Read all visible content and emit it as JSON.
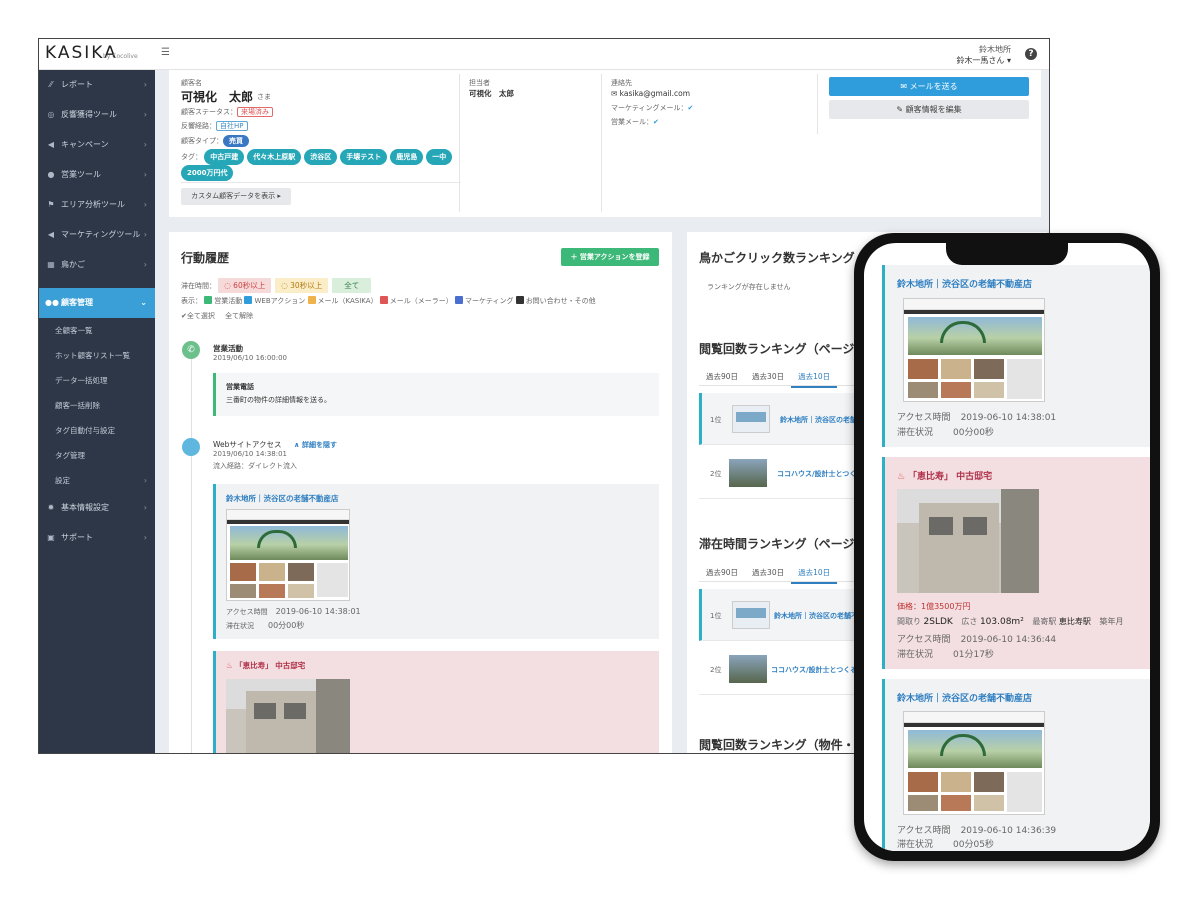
{
  "header": {
    "logo": "KASIKA",
    "logo_sub": "by Cocolive",
    "menu_icon": "☰",
    "company": "鈴木地所",
    "user": "鈴木一馬さん ▾"
  },
  "sidebar": {
    "items": [
      {
        "label": "レポート",
        "icon": "chart-icon"
      },
      {
        "label": "反響獲得ツール",
        "icon": "target-icon"
      },
      {
        "label": "キャンペーン",
        "icon": "megaphone-icon"
      },
      {
        "label": "営業ツール",
        "icon": "user-plus-icon"
      },
      {
        "label": "エリア分析ツール",
        "icon": "flag-icon"
      },
      {
        "label": "マーケティングツール",
        "icon": "bullhorn-icon"
      },
      {
        "label": "鳥かご",
        "icon": "grid-icon"
      },
      {
        "label": "顧客管理",
        "icon": "users-icon"
      }
    ],
    "sub_items": [
      "全顧客一覧",
      "ホット顧客リスト一覧",
      "データ一括処理",
      "顧客一括削除",
      "タグ自動付与設定",
      "タグ管理",
      "設定"
    ],
    "bottom_items": [
      {
        "label": "基本情報設定",
        "icon": "gear-icon"
      },
      {
        "label": "サポート",
        "icon": "id-card-icon"
      }
    ]
  },
  "profile": {
    "name_label": "顧客名",
    "name": "可視化　太郎",
    "honorific": "さま",
    "status_label": "顧客ステータス：",
    "status": "来場済み",
    "route_label": "反響経路：",
    "route": "自社HP",
    "type_label": "顧客タイプ：",
    "type": "売買",
    "tag_label": "タグ：",
    "tags": [
      "中古戸建",
      "代々木上原駅",
      "渋谷区",
      "手壊テスト",
      "鹿児島",
      "一中",
      "2000万円代"
    ],
    "custom_button": "カスタム顧客データを表示 ▸",
    "rep_label": "担当者",
    "rep": "可視化　太郎",
    "contact_label": "連絡先",
    "email": "kasika@gmail.com",
    "marketing_mail": "マーケティングメール：",
    "sales_mail": "営業メール：",
    "send_mail_button": "✉ メールを送る",
    "edit_button": "✎ 顧客情報を編集"
  },
  "activity": {
    "title": "行動履歴",
    "register_button": "＋ 営業アクションを登録",
    "stay_label": "滞在時間：",
    "stay_chips": [
      "60秒以上",
      "30秒以上",
      "全て"
    ],
    "display_label": "表示：",
    "filters": [
      {
        "label": "営業活動",
        "color": "#3cb878"
      },
      {
        "label": "WEBアクション",
        "color": "#2f9ddb"
      },
      {
        "label": "メール（KASIKA）",
        "color": "#f0b24a"
      },
      {
        "label": "メール（メーラー）",
        "color": "#e05555"
      },
      {
        "label": "マーケティング",
        "color": "#4a6fd0"
      },
      {
        "label": "お問い合わせ・その他",
        "color": "#333333"
      }
    ],
    "select_all": "✔全て選択",
    "deselect_all": "全て解除",
    "event1": {
      "title": "営業活動",
      "date": "2019/06/10 16:00:00",
      "note_title": "営業電話",
      "note_body": "三番町の物件の詳細情報を送る。"
    },
    "event2": {
      "title": "Webサイトアクセス",
      "toggle": "∧ 詳細を隠す",
      "date": "2019/06/10 14:38:01",
      "source": "流入経路：ダイレクト流入",
      "page_title": "鈴木地所｜渋谷区の老舗不動産店",
      "access_label": "アクセス時間",
      "access_time": "2019-06-10 14:38:01",
      "stay_label": "滞在状況",
      "stay_value": "00分00秒",
      "property_title": "「恵比寿」 中古邸宅"
    }
  },
  "ranking": {
    "birdcage_title": "鳥かごクリック数ランキング",
    "empty": "ランキングが存在しません",
    "views_title": "閲覧回数ランキング（ページ別）",
    "stay_title": "滞在時間ランキング（ページ別）",
    "property_title": "閲覧回数ランキング（物件・",
    "tabs": [
      "過去90日",
      "過去30日",
      "過去10日"
    ],
    "rows": [
      {
        "rank": "1位",
        "label": "鈴木地所｜渋谷区の老舗不動産店"
      },
      {
        "rank": "2位",
        "label": "ココハウス/設計士とつくる"
      }
    ]
  },
  "phone": {
    "cards": [
      {
        "title": "鈴木地所｜渋谷区の老舗不動産店",
        "access_label": "アクセス時間",
        "access_time": "2019-06-10 14:38:01",
        "stay_label": "滞在状況",
        "stay_value": "00分00秒"
      },
      {
        "title": "「恵比寿」 中古邸宅",
        "price": "価格：1億3500万円",
        "layout_label": "間取り",
        "layout": "2SLDK",
        "area_label": "広さ",
        "area": "103.08m²",
        "station_label": "最寄駅",
        "station": "恵比寿駅",
        "age_label": "築年月",
        "access_label": "アクセス時間",
        "access_time": "2019-06-10 14:36:44",
        "stay_label": "滞在状況",
        "stay_value": "01分17秒"
      },
      {
        "title": "鈴木地所｜渋谷区の老舗不動産店",
        "access_label": "アクセス時間",
        "access_time": "2019-06-10 14:36:39",
        "stay_label": "滞在状況",
        "stay_value": "00分05秒"
      }
    ]
  }
}
